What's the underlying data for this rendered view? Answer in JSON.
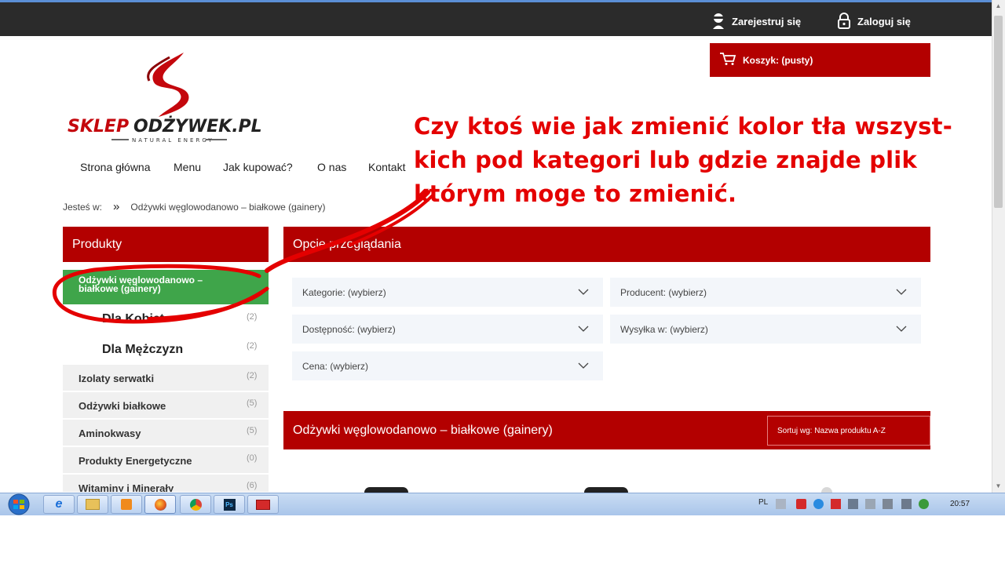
{
  "header": {
    "register_label": "Zarejestruj się",
    "login_label": "Zaloguj się",
    "cart_label": "Koszyk: (pusty)"
  },
  "logo": {
    "text_left": "SKLEP",
    "text_right": "ODŻYWEK.PL",
    "tagline": "NATURAL ENERGY"
  },
  "nav": {
    "items": [
      "Strona główna",
      "Menu",
      "Jak kupować?",
      "O nas",
      "Kontakt"
    ]
  },
  "breadcrumb": {
    "prefix": "Jesteś w:",
    "separator": "»",
    "current": "Odżywki węglowodanowo – białkowe (gainery)"
  },
  "sidebar": {
    "title": "Produkty",
    "active_line1": "Odżywki węglowodanowo –",
    "active_line2": "białkowe (gainery)",
    "subcategories": [
      {
        "label": "Dla Kobiet",
        "count": "(2)"
      },
      {
        "label": "Dla Mężczyzn",
        "count": "(2)"
      }
    ],
    "categories": [
      {
        "label": "Izolaty serwatki",
        "count": "(2)"
      },
      {
        "label": "Odżywki białkowe",
        "count": "(5)"
      },
      {
        "label": "Aminokwasy",
        "count": "(5)"
      },
      {
        "label": "Produkty Energetyczne",
        "count": "(0)"
      },
      {
        "label": "Witaminy i Minerały",
        "count": "(6)"
      }
    ]
  },
  "options": {
    "title": "Opcje przeglądania",
    "filters": [
      "Kategorie: (wybierz)",
      "Producent: (wybierz)",
      "Dostępność: (wybierz)",
      "Wysyłka w: (wybierz)",
      "Cena: (wybierz)"
    ]
  },
  "listing": {
    "title": "Odżywki węglowodanowo – białkowe (gainery)",
    "sort_label": "Sortuj wg: Nazwa produktu A-Z"
  },
  "annotation": {
    "line1": "Czy ktoś wie jak zmienić kolor tła wszyst-",
    "line2": "kich pod kategori lub gdzie znajde plik",
    "line3": "którym moge to zmienić."
  },
  "taskbar": {
    "language": "PL",
    "clock": "20:57"
  },
  "colors": {
    "brand_red": "#b30000",
    "highlight_green": "#3fa54a",
    "annotation_red": "#e40000",
    "topbar": "#2b2b2b"
  }
}
